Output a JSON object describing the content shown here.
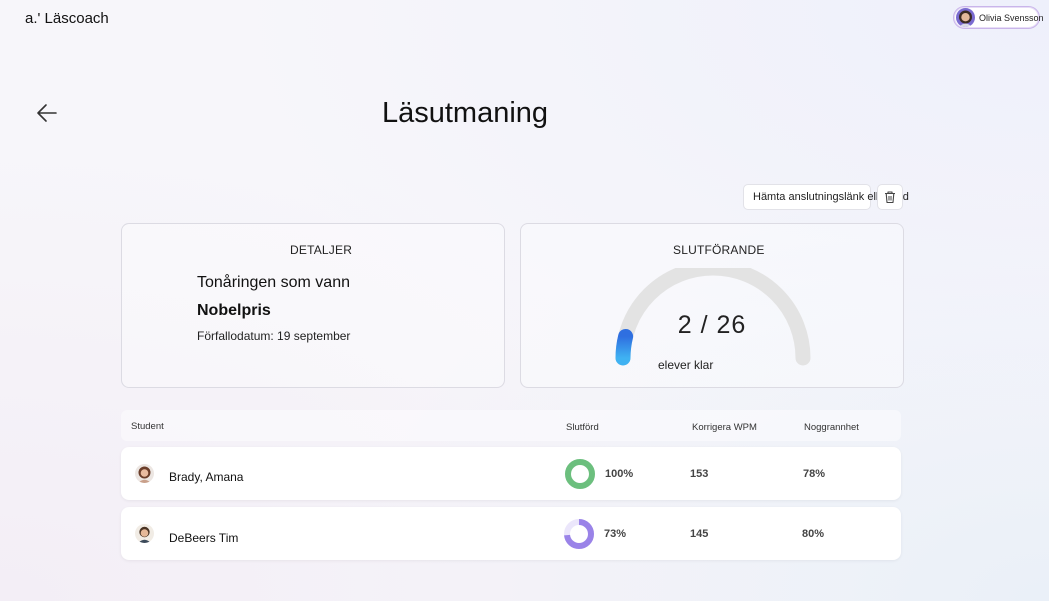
{
  "app": {
    "title": "a.' Läscoach"
  },
  "user": {
    "name": "Olivia Svensson"
  },
  "page": {
    "title": "Läsutmaning"
  },
  "toolbar": {
    "link_button_label": "Hämta anslutningslänk eller kod"
  },
  "details": {
    "heading": "DETALJER",
    "book_title_line1": "Tonåringen som vann",
    "book_title_line2": "Nobelpris",
    "due_date": "Förfallodatum: 19 september"
  },
  "completion": {
    "heading": "SLUTFÖRANDE",
    "completed": 2,
    "total": 26,
    "count_text": "2 / 26",
    "caption": "elever klar",
    "colors": {
      "track": "#e3e3e3",
      "fill_start": "#2f6fe0",
      "fill_end": "#3fb2f2"
    }
  },
  "table": {
    "columns": {
      "student": "Student",
      "done": "Slutförd",
      "wpm": "Korrigera WPM",
      "accuracy": "Noggrannhet"
    },
    "rows": [
      {
        "name": "Brady, Amana",
        "done": "100%",
        "done_fraction": 1.0,
        "wpm": "153",
        "accuracy": "78%",
        "ring_color": "#6cbf7e",
        "ring_track": "#e7f4ea"
      },
      {
        "name": "DeBeers Tim",
        "done": "73%",
        "done_fraction": 0.73,
        "wpm": "145",
        "accuracy": "80%",
        "ring_color": "#9a83e8",
        "ring_track": "#ebe6fb"
      }
    ]
  },
  "icons": {
    "back": "arrow-left-icon",
    "trash": "trash-icon"
  }
}
